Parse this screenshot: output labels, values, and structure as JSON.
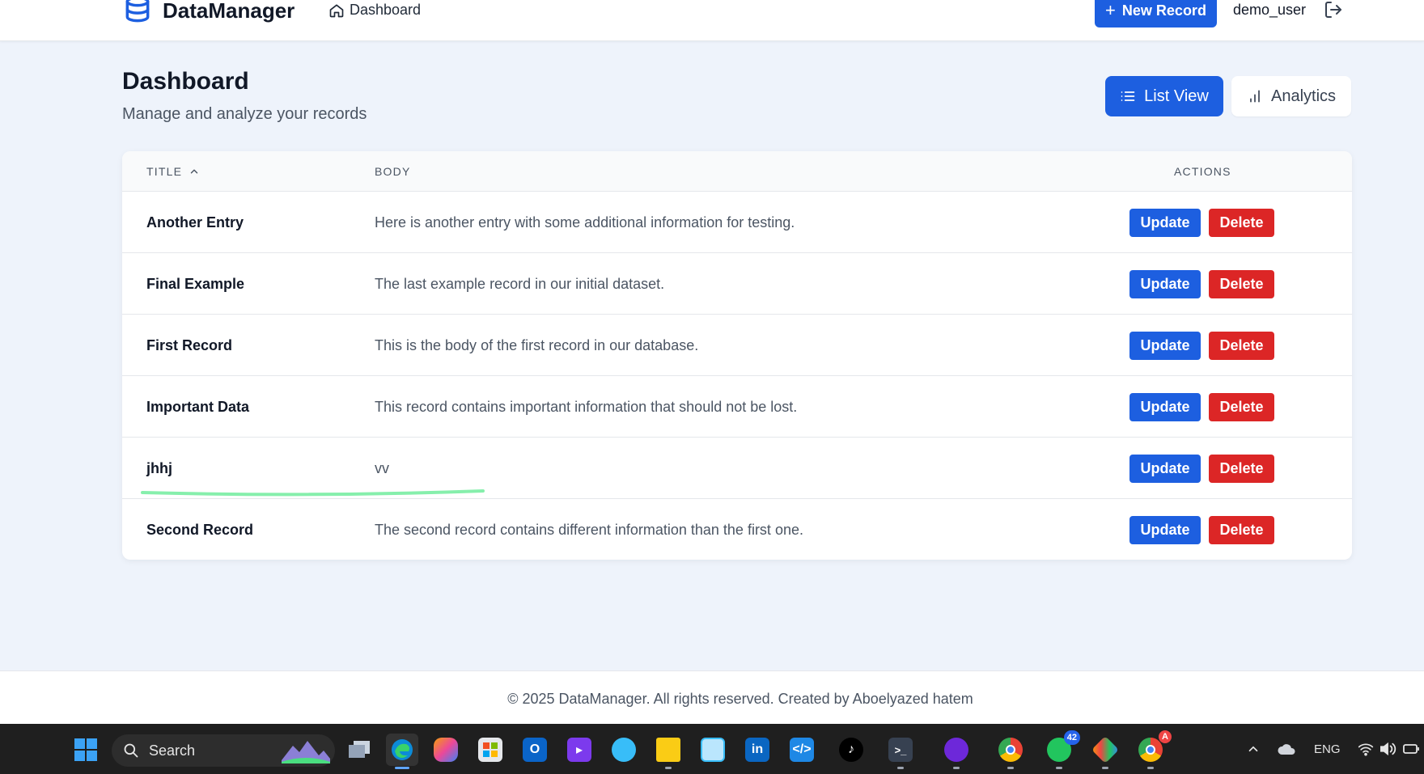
{
  "nav": {
    "brand": "DataManager",
    "dashboard_link": "Dashboard",
    "new_record": "New Record",
    "username": "demo_user"
  },
  "header": {
    "title": "Dashboard",
    "subtitle": "Manage and analyze your records",
    "list_view": "List View",
    "analytics": "Analytics"
  },
  "table": {
    "columns": {
      "title": "TITLE",
      "body": "BODY",
      "actions": "ACTIONS"
    },
    "sort": "ascending",
    "update_label": "Update",
    "delete_label": "Delete",
    "rows": [
      {
        "title": "Another Entry",
        "body": "Here is another entry with some additional information for testing."
      },
      {
        "title": "Final Example",
        "body": "The last example record in our initial dataset."
      },
      {
        "title": "First Record",
        "body": "This is the body of the first record in our database."
      },
      {
        "title": "Important Data",
        "body": "This record contains important information that should not be lost."
      },
      {
        "title": "jhhj",
        "body": "vv"
      },
      {
        "title": "Second Record",
        "body": "The second record contains different information than the first one."
      }
    ]
  },
  "footer": {
    "text": "© 2025 DataManager. All rights reserved. Created by Aboelyazed hatem"
  },
  "taskbar": {
    "search_label": "Search",
    "whatsapp_badge": "42",
    "chrome_badge": "A",
    "language": "ENG",
    "apps": [
      "file-view-icon",
      "edge-icon",
      "copilot-icon",
      "store-icon",
      "outlook-icon",
      "visual-studio-icon",
      "paint-icon",
      "file-explorer-icon",
      "notepad-icon",
      "linkedin-icon",
      "vscode-icon",
      "tiktok-icon",
      "terminal-icon",
      "github-icon",
      "chrome-icon",
      "whatsapp-icon",
      "git-icon",
      "chrome-profile-icon"
    ]
  },
  "colors": {
    "primary": "#1d5fe0",
    "danger": "#dc2626",
    "page_bg": "#eef3fb",
    "highlight": "#86efac"
  }
}
